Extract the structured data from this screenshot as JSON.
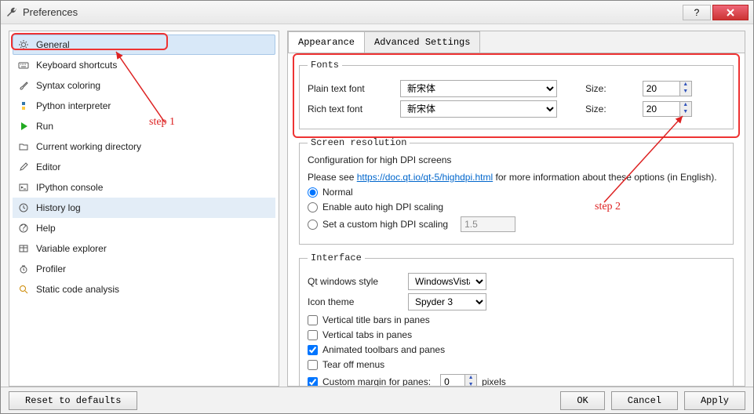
{
  "window": {
    "title": "Preferences"
  },
  "sidebar": {
    "items": [
      {
        "label": "General",
        "icon": "gear"
      },
      {
        "label": "Keyboard shortcuts",
        "icon": "keyboard"
      },
      {
        "label": "Syntax coloring",
        "icon": "brush"
      },
      {
        "label": "Python interpreter",
        "icon": "python"
      },
      {
        "label": "Run",
        "icon": "play"
      },
      {
        "label": "Current working directory",
        "icon": "folder"
      },
      {
        "label": "Editor",
        "icon": "edit"
      },
      {
        "label": "IPython console",
        "icon": "terminal"
      },
      {
        "label": "History log",
        "icon": "history"
      },
      {
        "label": "Help",
        "icon": "help"
      },
      {
        "label": "Variable explorer",
        "icon": "table"
      },
      {
        "label": "Profiler",
        "icon": "clock"
      },
      {
        "label": "Static code analysis",
        "icon": "search"
      }
    ],
    "selected_index": 0,
    "highlighted_index": 8
  },
  "tabs": [
    {
      "label": "Appearance",
      "active": true
    },
    {
      "label": "Advanced Settings",
      "active": false
    }
  ],
  "fonts": {
    "legend": "Fonts",
    "plain_label": "Plain text font",
    "plain_font": "新宋体",
    "plain_size_label": "Size:",
    "plain_size": "20",
    "rich_label": "Rich text font",
    "rich_font": "新宋体",
    "rich_size_label": "Size:",
    "rich_size": "20"
  },
  "screen": {
    "legend": "Screen resolution",
    "config_line": "Configuration for high DPI screens",
    "help_prefix": "Please see ",
    "help_link_text": "https://doc.qt.io/qt-5/highdpi.html",
    "help_suffix": " for more information about these options (in English).",
    "opt_normal": "Normal",
    "opt_auto": "Enable auto high DPI scaling",
    "opt_custom": "Set a custom high DPI scaling",
    "custom_value": "1.5"
  },
  "interface": {
    "legend": "Interface",
    "qt_label": "Qt windows style",
    "qt_value": "WindowsVista",
    "icon_label": "Icon theme",
    "icon_value": "Spyder 3",
    "chk_vert_title": "Vertical title bars in panes",
    "chk_vert_tabs": "Vertical tabs in panes",
    "chk_animated": "Animated toolbars and panes",
    "chk_tearoff": "Tear off menus",
    "chk_margin": "Custom margin for panes:",
    "margin_value": "0",
    "margin_unit": "pixels"
  },
  "annotations": {
    "step1": "step 1",
    "step2": "step 2"
  },
  "footer": {
    "reset": "Reset to defaults",
    "ok": "OK",
    "cancel": "Cancel",
    "apply": "Apply"
  }
}
